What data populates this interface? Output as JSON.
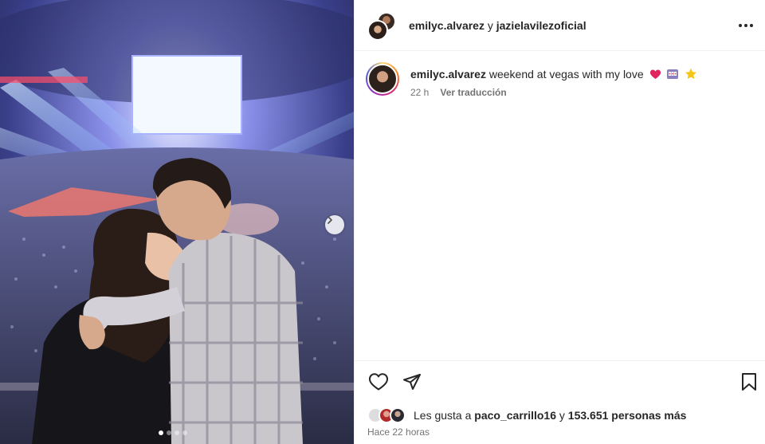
{
  "header": {
    "user1": "emilyc.alvarez",
    "separator": "y",
    "user2": "jazielavilezoficial"
  },
  "caption": {
    "username": "emilyc.alvarez",
    "text": "weekend at vegas with my love",
    "emojis": [
      "red-heart",
      "slot-machine",
      "star"
    ],
    "time": "22 h",
    "translate_label": "Ver traducción"
  },
  "likes": {
    "prefix": "Les gusta a",
    "liker": "paco_carrillo16",
    "connector": "y",
    "others": "153.651 personas más"
  },
  "post_time": "Hace 22 horas",
  "carousel": {
    "dots": 4,
    "active_index": 0
  },
  "icons": [
    "more-options-icon",
    "heart-icon",
    "share-icon",
    "bookmark-icon",
    "chevron-right-icon"
  ],
  "colors": {
    "text": "#262626",
    "muted": "#737373",
    "border": "#efefef",
    "heart": "#e0245e",
    "star": "#f5c518"
  }
}
